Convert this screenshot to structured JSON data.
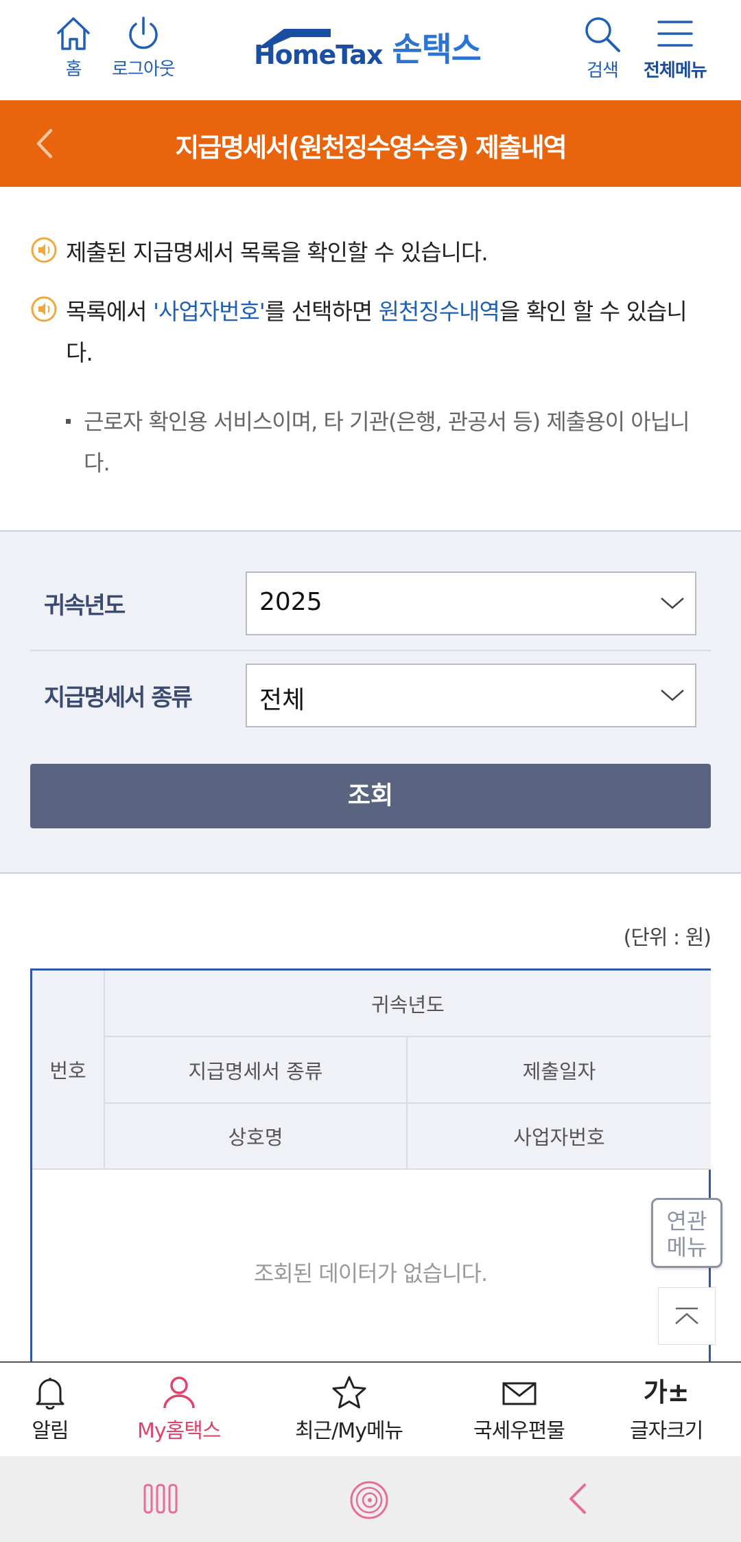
{
  "header": {
    "home_label": "홈",
    "logout_label": "로그아웃",
    "logo_text": "HomeTax",
    "logo_korean": "손택스",
    "search_label": "검색",
    "menu_label": "전체메뉴"
  },
  "titlebar": {
    "title": "지급명세서(원천징수영수증) 제출내역"
  },
  "notices": {
    "line1": "제출된 지급명세서 목록을 확인할 수 있습니다.",
    "line2_pre": "목록에서 ",
    "line2_link1": "'사업자번호'",
    "line2_mid": "를 선택하면 ",
    "line2_link2": "원천징수내역",
    "line2_post": "을 확인 할 수 있습니다.",
    "sub": "근로자 확인용 서비스이며, 타 기관(은행, 관공서 등) 제출용이 아닙니다."
  },
  "search": {
    "year_label": "귀속년도",
    "year_value": "2025",
    "type_label": "지급명세서 종류",
    "type_value": "전체",
    "button_label": "조회"
  },
  "results": {
    "unit": "(단위 : 원)",
    "headers": {
      "no": "번호",
      "year": "귀속년도",
      "type": "지급명세서 종류",
      "date": "제출일자",
      "company": "상호명",
      "bizno": "사업자번호"
    },
    "empty_message": "조회된 데이터가 없습니다."
  },
  "floating": {
    "related_menu_line1": "연관",
    "related_menu_line2": "메뉴"
  },
  "bottom_nav": {
    "alarm": "알림",
    "my_hometax": "My홈택스",
    "recent": "최근/My메뉴",
    "mail": "국세우편물",
    "font_size_icon": "가±",
    "font_size": "글자크기"
  },
  "colors": {
    "brand_orange": "#e8640d",
    "brand_blue": "#1f5fb5",
    "button_slate": "#596580",
    "active_pink": "#e0426a"
  }
}
